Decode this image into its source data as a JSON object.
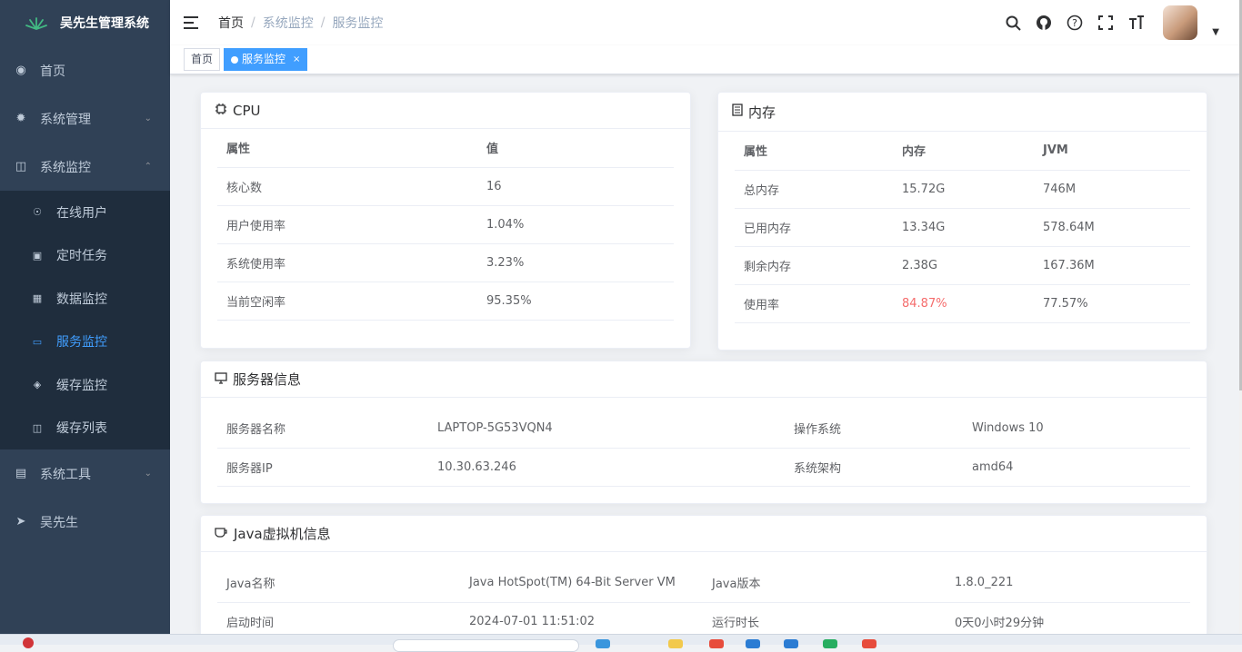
{
  "app": {
    "title": "吴先生管理系统"
  },
  "sidebar": {
    "items": [
      {
        "label": "首页",
        "icon": "dashboard-icon"
      },
      {
        "label": "系统管理",
        "icon": "gear-icon"
      },
      {
        "label": "系统监控",
        "icon": "monitor-icon"
      },
      {
        "label": "系统工具",
        "icon": "toolbox-icon"
      },
      {
        "label": "吴先生",
        "icon": "paper-plane-icon"
      }
    ],
    "monitor_children": [
      {
        "label": "在线用户",
        "icon": "online-icon"
      },
      {
        "label": "定时任务",
        "icon": "job-icon"
      },
      {
        "label": "数据监控",
        "icon": "druid-icon"
      },
      {
        "label": "服务监控",
        "icon": "server-icon"
      },
      {
        "label": "缓存监控",
        "icon": "redis-icon"
      },
      {
        "label": "缓存列表",
        "icon": "redis-list-icon"
      }
    ]
  },
  "navbar": {
    "breadcrumb": [
      "首页",
      "系统监控",
      "服务监控"
    ]
  },
  "tags": {
    "home": "首页",
    "active": "服务监控",
    "close": "×"
  },
  "cpu": {
    "title": "CPU",
    "headers": [
      "属性",
      "值"
    ],
    "rows": [
      [
        "核心数",
        "16"
      ],
      [
        "用户使用率",
        "1.04%"
      ],
      [
        "系统使用率",
        "3.23%"
      ],
      [
        "当前空闲率",
        "95.35%"
      ]
    ]
  },
  "mem": {
    "title": "内存",
    "headers": [
      "属性",
      "内存",
      "JVM"
    ],
    "rows": [
      [
        "总内存",
        "15.72G",
        "746M"
      ],
      [
        "已用内存",
        "13.34G",
        "578.64M"
      ],
      [
        "剩余内存",
        "2.38G",
        "167.36M"
      ],
      [
        "使用率",
        "84.87%",
        "77.57%"
      ]
    ],
    "danger_color": "#f56c6c"
  },
  "server": {
    "title": "服务器信息",
    "rows": [
      [
        "服务器名称",
        "LAPTOP-5G53VQN4",
        "操作系统",
        "Windows 10"
      ],
      [
        "服务器IP",
        "10.30.63.246",
        "系统架构",
        "amd64"
      ]
    ]
  },
  "jvm": {
    "title": "Java虚拟机信息",
    "rows": [
      [
        "Java名称",
        "Java HotSpot(TM) 64-Bit Server VM",
        "Java版本",
        "1.8.0_221"
      ],
      [
        "启动时间",
        "2024-07-01 11:51:02",
        "运行时长",
        "0天0小时29分钟"
      ]
    ]
  },
  "colors": {
    "sidebar_bg": "#304156",
    "submenu_bg": "#1f2d3d",
    "accent": "#409eff"
  }
}
